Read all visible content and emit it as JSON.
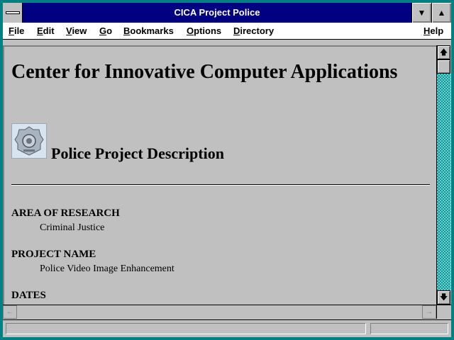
{
  "window": {
    "title": "CICA Project Police",
    "minimize_glyph": "▼",
    "maximize_glyph": "▲"
  },
  "menu": {
    "items": [
      {
        "u": "F",
        "rest": "ile"
      },
      {
        "u": "E",
        "rest": "dit"
      },
      {
        "u": "V",
        "rest": "iew"
      },
      {
        "u": "G",
        "rest": "o"
      },
      {
        "u": "B",
        "rest": "ookmarks"
      },
      {
        "u": "O",
        "rest": "ptions"
      },
      {
        "u": "D",
        "rest": "irectory"
      }
    ],
    "help": {
      "u": "H",
      "rest": "elp"
    }
  },
  "document": {
    "heading": "Center for Innovative Computer Applications",
    "subheading": "Police Project Description",
    "badge_icon": "police-badge-image",
    "sections": [
      {
        "term": "AREA OF RESEARCH",
        "value": "Criminal Justice"
      },
      {
        "term": "PROJECT NAME",
        "value": "Police Video Image Enhancement"
      },
      {
        "term": "DATES",
        "value": ""
      }
    ]
  },
  "scrollbars": {
    "up_glyph": "🡅",
    "down_glyph": "🡇",
    "left_glyph": "←",
    "right_glyph": "→"
  },
  "status": {
    "text": ""
  },
  "colors": {
    "titlebar": "#000080",
    "frame": "#008080",
    "background": "#c0c0c0"
  }
}
